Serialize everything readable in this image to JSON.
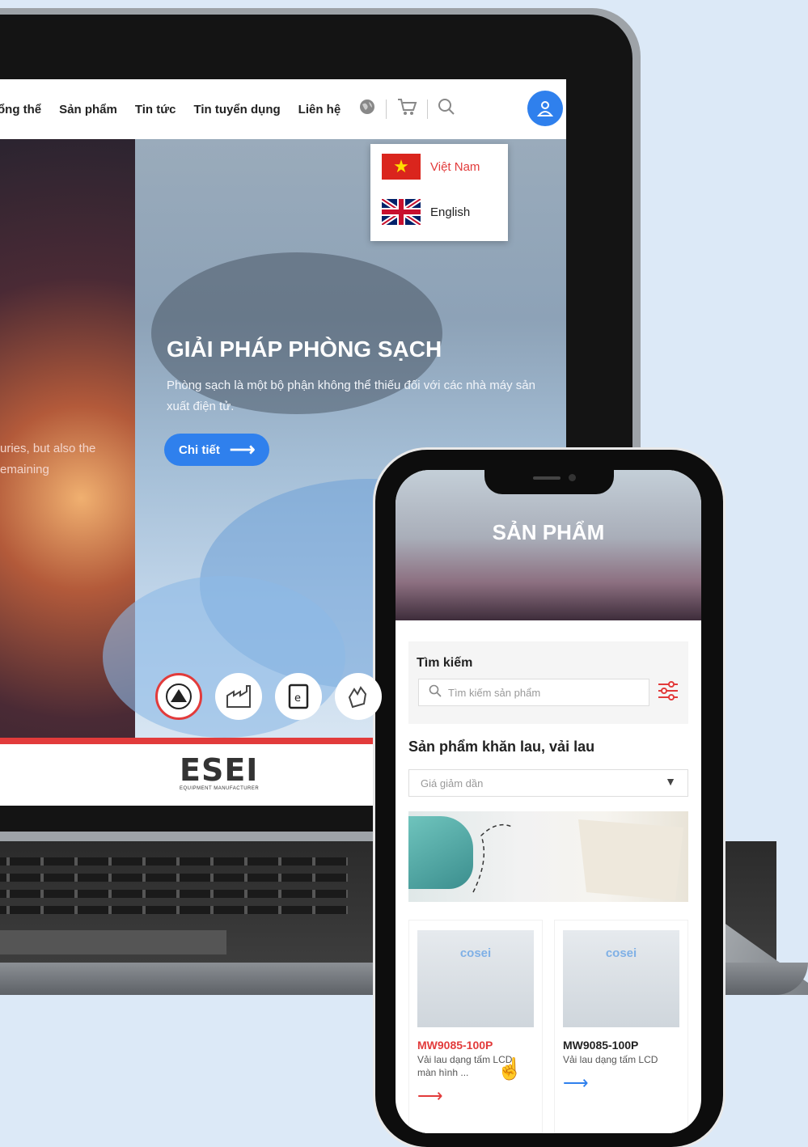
{
  "laptop": {
    "nav": {
      "items": [
        "tổng thể",
        "Sản phẩm",
        "Tin tức",
        "Tin tuyển dụng",
        "Liên hệ"
      ],
      "icons": [
        "globe-icon",
        "cart-icon",
        "search-icon",
        "user-icon"
      ]
    },
    "language_dropdown": [
      {
        "label": "Việt Nam",
        "flag": "vn",
        "color": "#e23b3b"
      },
      {
        "label": "English",
        "flag": "uk",
        "color": "#222222"
      }
    ],
    "hero": {
      "left_text_line1": "uries, but also the",
      "left_text_line2": "emaining",
      "title": "GIẢI PHÁP PHÒNG SẠCH",
      "description": "Phòng sạch là một bộ phận không thể thiếu đối với các nhà máy sản xuất điện tử.",
      "button_label": "Chi tiết"
    },
    "category_icons": [
      "esd-icon",
      "factory-icon",
      "document-icon",
      "glove-icon"
    ],
    "footer_logo": "ESEI",
    "footer_logo_sub": "EQUIPMENT MANUFACTURER"
  },
  "phone": {
    "banner_title": "SẢN PHẨM",
    "search_label": "Tìm kiếm",
    "search_placeholder": "Tìm kiếm sản phẩm",
    "section_title": "Sản phẩm khăn lau, vải lau",
    "sort_selected": "Giá giảm dần",
    "products": [
      {
        "brand": "cosei",
        "code": "MW9085-100P",
        "desc": "Vải lau dạng tấm LCD, màn hình ...",
        "code_color": "#e23b3b",
        "arrow_color": "#e23b3b"
      },
      {
        "brand": "cosei",
        "code": "MW9085-100P",
        "desc": "Vải lau dạng tấm LCD",
        "code_color": "#222222",
        "arrow_color": "#2f80ed"
      }
    ]
  },
  "colors": {
    "accent_blue": "#2f80ed",
    "accent_red": "#e23b3b"
  }
}
